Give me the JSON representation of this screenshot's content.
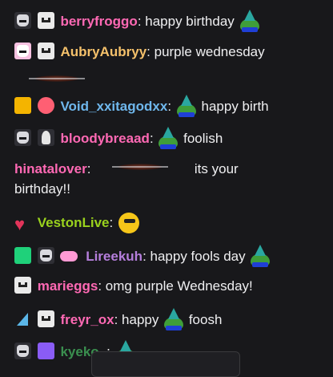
{
  "chat": {
    "messages": [
      {
        "user": "berryfroggo",
        "sep": ":",
        "text": " happy birthday",
        "color": "#ff69b4"
      },
      {
        "user": "AubryAubryy",
        "sep": ":",
        "text": " purple wednesday",
        "color": "#f5c16b"
      },
      {
        "user": "Void_xxitagodxx",
        "sep": ":",
        "text": " happy birth",
        "color": "#6fb7ec"
      },
      {
        "user": "bloodybreaad",
        "sep": ":",
        "text": " foolish",
        "color": "#ff69b4"
      },
      {
        "user": "hinatalover",
        "sep": ":",
        "text_a": "its your",
        "text_b": "birthday!!",
        "color": "#ff69b4"
      },
      {
        "user": "VestonLive",
        "sep": ":",
        "text": "",
        "color": "#9ad21d"
      },
      {
        "user": "Lireekuh",
        "sep": ":",
        "text": " happy fools day",
        "color": "#b57edc"
      },
      {
        "user": "marieggs",
        "sep": ":",
        "text": " omg purple Wednesday!",
        "color": "#ff69b4"
      },
      {
        "user": "freyr_ox",
        "sep": ":",
        "text": " happy",
        "text_b": "foosh",
        "color": "#ff69b4"
      },
      {
        "user": "kyeko_",
        "sep": ":",
        "text": "",
        "color": "#3a8f4f"
      }
    ]
  },
  "icons": {
    "badge_monster": "monster-badge-icon",
    "badge_face": "face-badge-icon",
    "emote_party_frog": "party-frog-emote",
    "emote_smiley": "sunglasses-smiley-emote",
    "emote_disc": "spinning-disc-emote"
  }
}
